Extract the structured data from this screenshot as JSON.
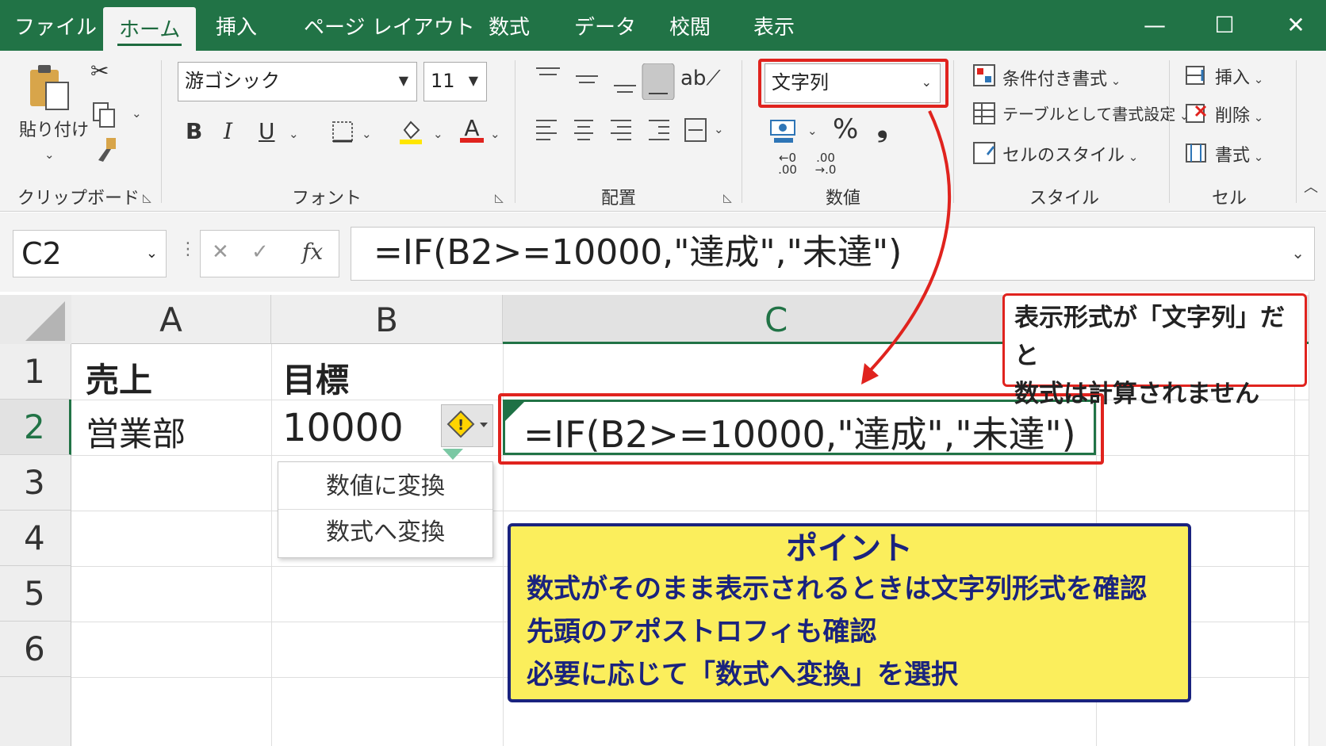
{
  "tabs": [
    "ファイル",
    "ホーム",
    "挿入",
    "ページ レイアウト",
    "数式",
    "データ",
    "校閲",
    "表示"
  ],
  "active_tab": "ホーム",
  "ribbon": {
    "clipboard": {
      "paste_label": "貼り付け",
      "group_label": "クリップボード"
    },
    "font": {
      "name": "游ゴシック",
      "size": "11",
      "bold": "B",
      "italic": "I",
      "underline": "U",
      "font_color_glyph": "A",
      "group_label": "フォント"
    },
    "alignment": {
      "group_label": "配置"
    },
    "number": {
      "format": "文字列",
      "percent": "%",
      "comma": "❟",
      "group_label": "数値",
      "inc_decimal": "←0 .00",
      "dec_decimal": ".00 →.0"
    },
    "styles": {
      "conditional": "条件付き書式",
      "table": "テーブルとして書式設定",
      "cell_styles": "セルのスタイル",
      "group_label": "スタイル"
    },
    "cells": {
      "insert": "挿入",
      "delete": "削除",
      "format": "書式",
      "group_label": "セル"
    }
  },
  "formula_bar": {
    "name_box": "C2",
    "fx": "fx",
    "cancel": "✕",
    "enter": "✓",
    "formula": "=IF(B2>=10000,\"達成\",\"未達\")"
  },
  "columns": [
    "A",
    "B",
    "C"
  ],
  "rows": [
    "1",
    "2",
    "3",
    "4",
    "5",
    "6"
  ],
  "cells": {
    "A1": "売上",
    "B1": "目標",
    "A2": "営業部",
    "B2": "10000",
    "C2": "=IF(B2>=10000,\"達成\",\"未達\")"
  },
  "context_menu": {
    "items": [
      "数値に変換",
      "数式へ変換"
    ]
  },
  "callout": {
    "line1": "表示形式が「文字列」だと",
    "line2": "数式は計算されません"
  },
  "point": {
    "title": "ポイント",
    "lines": [
      "数式がそのまま表示されるときは文字列形式を確認",
      "先頭のアポストロフィも確認",
      "必要に応じて「数式へ変換」を選択"
    ]
  },
  "colors": {
    "excel_green": "#217346",
    "highlight_red": "#e0231e",
    "point_fill": "#fbee5c",
    "point_border": "#1a237e"
  }
}
